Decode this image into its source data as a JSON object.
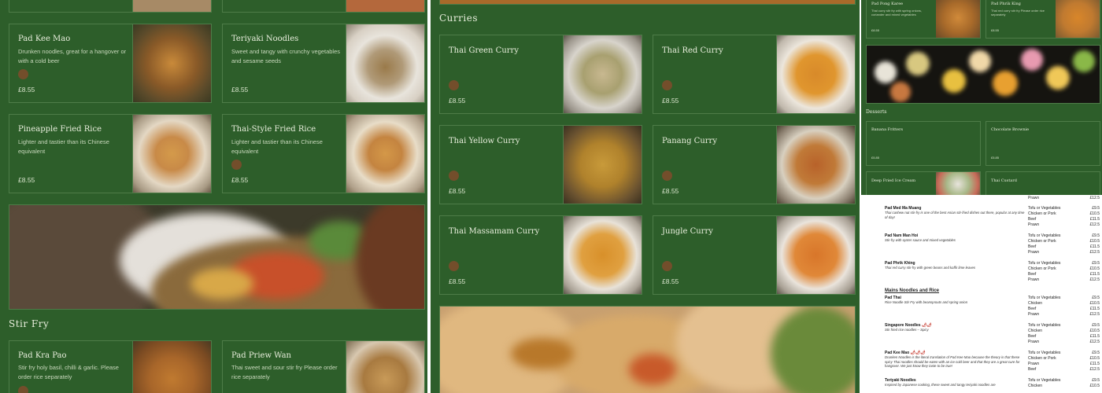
{
  "panel1": {
    "top_cards": [
      {
        "name": "Pad Kee Mao",
        "desc": "Drunken noodles, great for a hangover or with a cold beer",
        "price": "£8.55"
      },
      {
        "name": "Teriyaki Noodles",
        "desc": "Sweet and tangy with crunchy vegetables and sesame seeds",
        "price": "£8.55"
      },
      {
        "name": "Pineapple Fried Rice",
        "desc": "Lighter and tastier than its Chinese equivalent",
        "price": "£8.55"
      },
      {
        "name": "Thai-Style Fried Rice",
        "desc": "Lighter and tastier than its Chinese equivalent",
        "price": "£8.55"
      }
    ],
    "section_title": "Stir Fry",
    "bottom_cards": [
      {
        "name": "Pad Kra Pao",
        "desc": "Stir fry holy basil, chilli & garlic. Please order rice separately"
      },
      {
        "name": "Pad Priew Wan",
        "desc": "Thai sweet and sour stir fry Please order rice separately"
      }
    ]
  },
  "panel2": {
    "section_title": "Curries",
    "cards": [
      {
        "name": "Thai Green Curry",
        "price": "£8.55"
      },
      {
        "name": "Thai Red Curry",
        "price": "£8.55"
      },
      {
        "name": "Thai Yellow Curry",
        "price": "£8.55"
      },
      {
        "name": "Panang Curry",
        "price": "£8.55"
      },
      {
        "name": "Thai Massamam Curry",
        "price": "£8.55"
      },
      {
        "name": "Jungle Curry",
        "price": "£8.55"
      }
    ]
  },
  "panel3": {
    "top_cards": [
      {
        "name": "Pad Pong Karee",
        "desc": "Thai curry stir fry with spring onions, coriander and mixed vegetables",
        "price": "£8.55"
      },
      {
        "name": "Pad Phrik King",
        "desc": "Thai red curry stir fry Please order rice separately",
        "price": "£8.55"
      }
    ],
    "section_title": "Desserts",
    "dessert_cards": [
      {
        "name": "Banana Fritters",
        "price": "£5.85"
      },
      {
        "name": "Chocolate Brownie",
        "price": "£5.85"
      },
      {
        "name": "Deep Fried Ice Cream"
      },
      {
        "name": "Thai Custard"
      }
    ]
  },
  "panel4": {
    "top_rows": [
      {
        "opts": [
          "Prawn"
        ],
        "prices": [
          "£12.5"
        ]
      }
    ],
    "items": [
      {
        "name": "Pad Med Ma Muang",
        "desc": "Thai cashew nut stir-fry is one of the best Asian stir-fried dishes out there, popular at any time of day!",
        "opts": [
          "Tofu or Vegetables",
          "Chicken or Pork",
          "Beef",
          "Prawn"
        ],
        "prices": [
          "£9.5",
          "£10.5",
          "£11.5",
          "£12.5"
        ]
      },
      {
        "name": "Pad Nam Man Hoi",
        "desc": "Stir-fry with oyster sauce and mixed vegetables",
        "opts": [
          "Tofu or Vegetables",
          "Chicken or Pork",
          "Beef",
          "Prawn"
        ],
        "prices": [
          "£9.5",
          "£10.5",
          "£11.5",
          "£12.5"
        ]
      },
      {
        "name": "Pad Phrik Khing",
        "desc": "Thai red curry stir-fry with green beans and kaffir lime leaves",
        "opts": [
          "Tofu or Vegetables",
          "Chicken or Pork",
          "Beef",
          "Prawn"
        ],
        "prices": [
          "£9.5",
          "£10.5",
          "£11.5",
          "£12.5"
        ]
      }
    ],
    "section_title": "Mains Noodles and Rice",
    "noodle_items": [
      {
        "name": "Pad Thai",
        "desc": "Rice Noodle Stir Fry with beansprouts and spring onion",
        "opts": [
          "Tofu or Vegetables",
          "Chicken",
          "Beef",
          "Prawn"
        ],
        "prices": [
          "£9.5",
          "£10.5",
          "£11.5",
          "£12.5"
        ]
      },
      {
        "name": "Singapore Noodles",
        "hot": "🌶🌶",
        "desc": "Stir fried rice noodles – Spicy",
        "opts": [
          "Tofu or Vegetables",
          "Chicken",
          "Beef",
          "Prawn"
        ],
        "prices": [
          "£9.5",
          "£10.5",
          "£11.5",
          "£12.5"
        ]
      },
      {
        "name": "Pad Kee Mao",
        "hot": "🌶🌶🌶",
        "desc": "Drunken Noodles is the literal translation of Pad Kee Mao because the theory is that these spicy Thai noodles should be eaten with an ice cold beer and that they are a great cure for hangover. We just know they taste to be true!",
        "opts": [
          "Tofu or Vegetables",
          "Chicken or Pork",
          "Prawn",
          "Beef"
        ],
        "prices": [
          "£9.5",
          "£10.5",
          "£11.5",
          "£12.5"
        ]
      },
      {
        "name": "Teriyaki Noodles",
        "desc": "Inspired by Japanese cooking, these sweet and tangy teriyaki noodles are",
        "opts": [
          "Tofu or Vegetables",
          "Chicken"
        ],
        "prices": [
          "£9.5",
          "£10.5"
        ]
      }
    ]
  }
}
